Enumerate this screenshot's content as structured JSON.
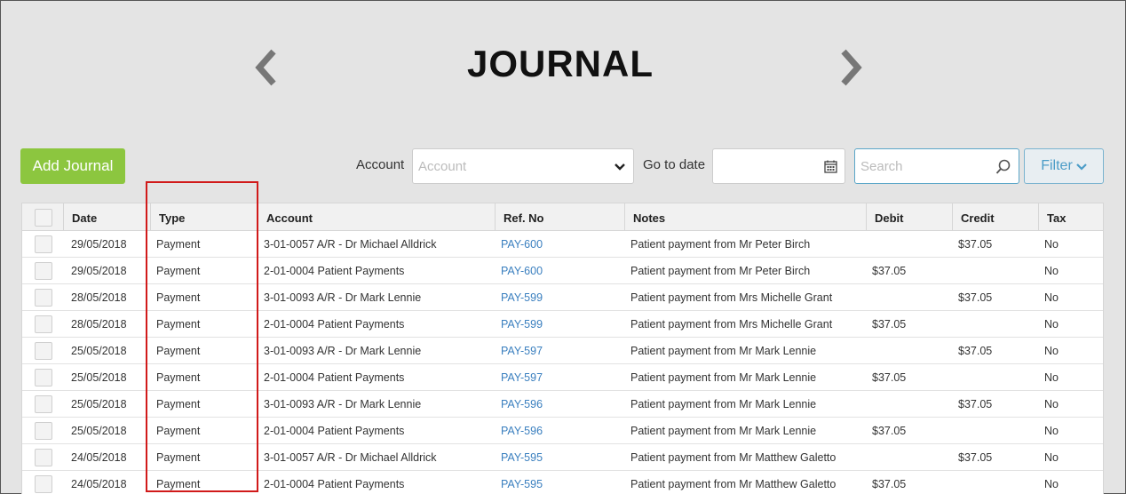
{
  "page": {
    "title": "JOURNAL"
  },
  "toolbar": {
    "add_label": "Add Journal",
    "account_label": "Account",
    "account_placeholder": "Account",
    "date_label": "Go to date",
    "search_placeholder": "Search",
    "filter_label": "Filter"
  },
  "table": {
    "headers": {
      "date": "Date",
      "type": "Type",
      "account": "Account",
      "ref": "Ref. No",
      "notes": "Notes",
      "debit": "Debit",
      "credit": "Credit",
      "tax": "Tax"
    },
    "rows": [
      {
        "date": "29/05/2018",
        "type": "Payment",
        "account": "3-01-0057 A/R - Dr Michael Alldrick",
        "ref": "PAY-600",
        "notes": "Patient payment from Mr Peter Birch",
        "debit": "",
        "credit": "$37.05",
        "tax": "No"
      },
      {
        "date": "29/05/2018",
        "type": "Payment",
        "account": "2-01-0004 Patient Payments",
        "ref": "PAY-600",
        "notes": "Patient payment from Mr Peter Birch",
        "debit": "$37.05",
        "credit": "",
        "tax": "No"
      },
      {
        "date": "28/05/2018",
        "type": "Payment",
        "account": "3-01-0093 A/R - Dr Mark Lennie",
        "ref": "PAY-599",
        "notes": "Patient payment from Mrs Michelle Grant",
        "debit": "",
        "credit": "$37.05",
        "tax": "No"
      },
      {
        "date": "28/05/2018",
        "type": "Payment",
        "account": "2-01-0004 Patient Payments",
        "ref": "PAY-599",
        "notes": "Patient payment from Mrs Michelle Grant",
        "debit": "$37.05",
        "credit": "",
        "tax": "No"
      },
      {
        "date": "25/05/2018",
        "type": "Payment",
        "account": "3-01-0093 A/R - Dr Mark Lennie",
        "ref": "PAY-597",
        "notes": "Patient payment from Mr Mark Lennie",
        "debit": "",
        "credit": "$37.05",
        "tax": "No"
      },
      {
        "date": "25/05/2018",
        "type": "Payment",
        "account": "2-01-0004 Patient Payments",
        "ref": "PAY-597",
        "notes": "Patient payment from Mr Mark Lennie",
        "debit": "$37.05",
        "credit": "",
        "tax": "No"
      },
      {
        "date": "25/05/2018",
        "type": "Payment",
        "account": "3-01-0093 A/R - Dr Mark Lennie",
        "ref": "PAY-596",
        "notes": "Patient payment from Mr Mark Lennie",
        "debit": "",
        "credit": "$37.05",
        "tax": "No"
      },
      {
        "date": "25/05/2018",
        "type": "Payment",
        "account": "2-01-0004 Patient Payments",
        "ref": "PAY-596",
        "notes": "Patient payment from Mr Mark Lennie",
        "debit": "$37.05",
        "credit": "",
        "tax": "No"
      },
      {
        "date": "24/05/2018",
        "type": "Payment",
        "account": "3-01-0057 A/R - Dr Michael Alldrick",
        "ref": "PAY-595",
        "notes": "Patient payment from Mr Matthew Galetto",
        "debit": "",
        "credit": "$37.05",
        "tax": "No"
      },
      {
        "date": "24/05/2018",
        "type": "Payment",
        "account": "2-01-0004 Patient Payments",
        "ref": "PAY-595",
        "notes": "Patient payment from Mr Matthew Galetto",
        "debit": "$37.05",
        "credit": "",
        "tax": "No"
      }
    ]
  },
  "icons": {
    "prev": "chevron-left-icon",
    "next": "chevron-right-icon",
    "dropdown": "chevron-down-icon",
    "calendar": "calendar-icon",
    "search": "search-icon"
  },
  "colors": {
    "add_button": "#8cc63f",
    "link": "#3a7fbf",
    "filter": "#4b9cc7",
    "highlight": "#d11a1a"
  }
}
